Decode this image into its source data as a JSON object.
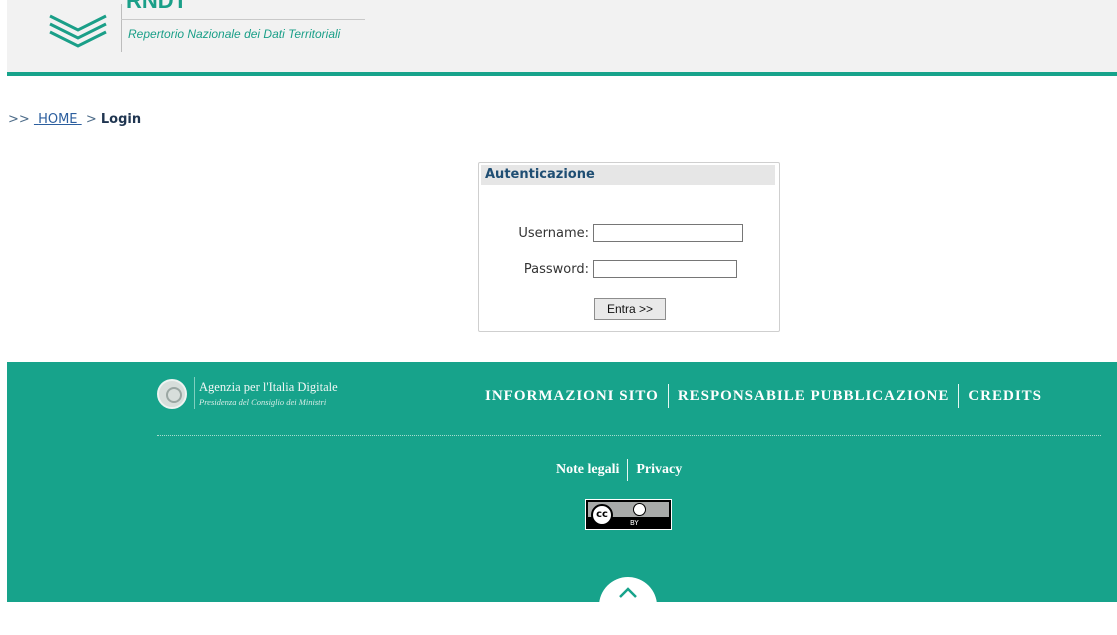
{
  "header": {
    "logo_partial_text": "RNDT",
    "subtitle": "Repertorio Nazionale dei Dati Territoriali",
    "brand_color": "#1a9f88",
    "bar_color": "#17a38b"
  },
  "breadcrumb": {
    "prefix": ">>",
    "home": "HOME",
    "separator": ">",
    "current": "Login"
  },
  "login": {
    "title": "Autenticazione",
    "username_label": "Username:",
    "username_value": "",
    "password_label": "Password:",
    "password_value": "",
    "submit_label": "Entra >>"
  },
  "footer": {
    "background": "#17a38b",
    "agency_name": "Agenzia per l'Italia Digitale",
    "agency_sub": "Presidenza del Consiglio dei Ministri",
    "agency_icon": "republic-emblem-icon",
    "links_top": [
      "INFORMAZIONI SITO",
      "RESPONSABILE PUBBLICAZIONE",
      "CREDITS"
    ],
    "links_bottom": [
      "Note legali",
      "Privacy"
    ],
    "license_badge": {
      "cc": "cc",
      "by": "BY"
    },
    "back_to_top_icon": "chevron-up-icon"
  }
}
